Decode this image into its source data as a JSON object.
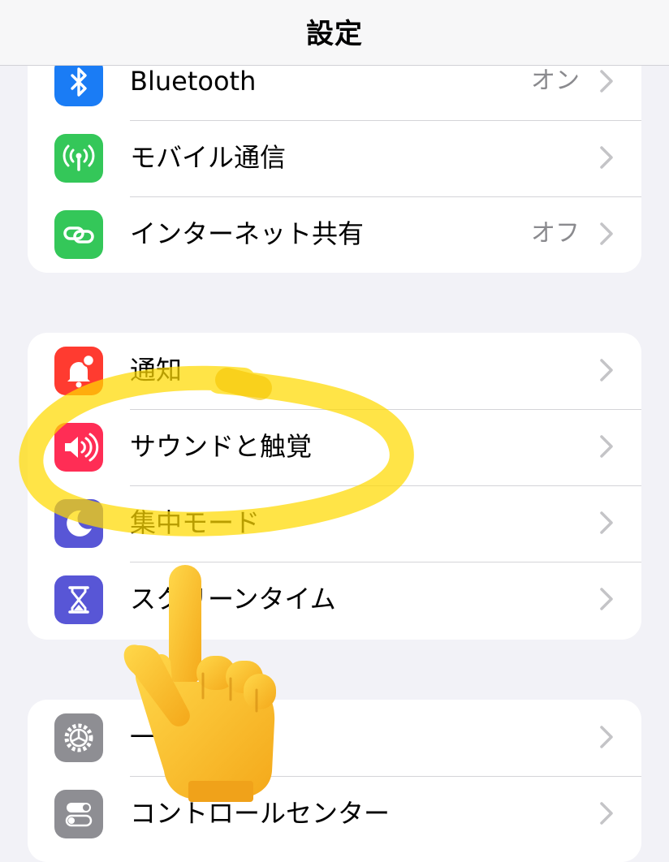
{
  "header": {
    "title": "設定"
  },
  "groups": [
    {
      "items": [
        {
          "label": "Bluetooth",
          "value": "オン",
          "icon": "bluetooth-icon",
          "icon_color": "#1a7cf5"
        },
        {
          "label": "モバイル通信",
          "value": "",
          "icon": "antenna-icon",
          "icon_color": "#34c759"
        },
        {
          "label": "インターネット共有",
          "value": "オフ",
          "icon": "link-icon",
          "icon_color": "#34c759"
        }
      ]
    },
    {
      "items": [
        {
          "label": "通知",
          "value": "",
          "icon": "bell-icon",
          "icon_color": "#ff3b30"
        },
        {
          "label": "サウンドと触覚",
          "value": "",
          "icon": "speaker-icon",
          "icon_color": "#ff2d55"
        },
        {
          "label": "集中モード",
          "value": "",
          "icon": "moon-icon",
          "icon_color": "#5856d6"
        },
        {
          "label": "スクリーンタイム",
          "value": "",
          "icon": "hourglass-icon",
          "icon_color": "#5856d6"
        }
      ]
    },
    {
      "items": [
        {
          "label": "一般",
          "value": "",
          "icon": "gear-icon",
          "icon_color": "#8e8e93"
        },
        {
          "label": "コントロールセンター",
          "value": "",
          "icon": "switches-icon",
          "icon_color": "#8e8e93"
        }
      ]
    }
  ],
  "annotation": {
    "highlight": "yellow-circle-around-sound",
    "highlight_color": "#ffd900",
    "pointer": "pointing-up-hand-emoji"
  }
}
